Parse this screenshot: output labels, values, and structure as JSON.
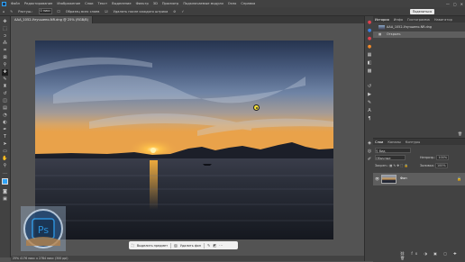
{
  "menubar": {
    "items": [
      "Файл",
      "Редактирование",
      "Изображение",
      "Слои",
      "Текст",
      "Выделение",
      "Фильтр",
      "3D",
      "Просмотр",
      "Подключаемые модули",
      "Окно",
      "Справка"
    ],
    "controls": [
      "—",
      "▢",
      "✕"
    ]
  },
  "options": {
    "feather_label": "Растуш.:",
    "feather_value": "0 пикс",
    "sample_all_layers": "Образец всех слоев",
    "auto_enhance": "Удалять после каждого штриха",
    "share_label": "Поделиться"
  },
  "document": {
    "tab_title": "AAA_1052-Улучшено-NR.dng @ 25% (RGB/8)"
  },
  "taskbar": {
    "select_subject": "Выделить предмет",
    "remove_bg": "Удалить фон"
  },
  "status": {
    "text": "25%   4176 пикс x 2784 пикс (300 ppi)"
  },
  "history": {
    "tabs": [
      "История",
      "Инфо",
      "Гистограмма",
      "Навигатор"
    ],
    "items": [
      "AAA_1052-Улучшено-NR.dng",
      "Открыть"
    ]
  },
  "layers": {
    "tabs": [
      "Слои",
      "Каналы",
      "Контуры"
    ],
    "kind_label": "Вид",
    "blend_mode": "Обычные",
    "opacity_label": "Непрозр.:",
    "opacity_value": "100%",
    "lock_label": "Закреп.:",
    "fill_label": "Заливка:",
    "fill_value": "100%",
    "layer_name": "Фон"
  },
  "watermark": {
    "logo_text": "Ps"
  },
  "colors": {
    "accent": "#2fa3f7",
    "panel": "#424242",
    "workspace": "#535353"
  }
}
